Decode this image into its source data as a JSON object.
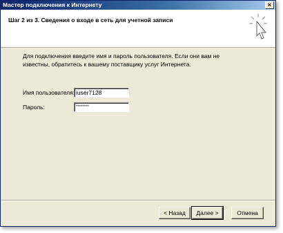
{
  "window": {
    "title": "Мастер подключения к Интернету"
  },
  "header": {
    "title": "Шаг 2 из 3. Сведения о входе в сеть для учетной записи",
    "icon": "wizard-cursor-icon"
  },
  "main": {
    "intro": "Для подключения введите имя и пароль пользователя. Если они вам не известны, обратитесь к вашему поставщику услуг Интернета.",
    "username_label": "Имя пользователя:",
    "username_value": "iuser7128",
    "password_label": "Пароль:",
    "password_value": "********"
  },
  "buttons": {
    "back": "< Назад",
    "next": "Далее >",
    "cancel": "Отмена"
  },
  "colors": {
    "titlebar": "#0a246a",
    "face": "#ece9d8"
  }
}
